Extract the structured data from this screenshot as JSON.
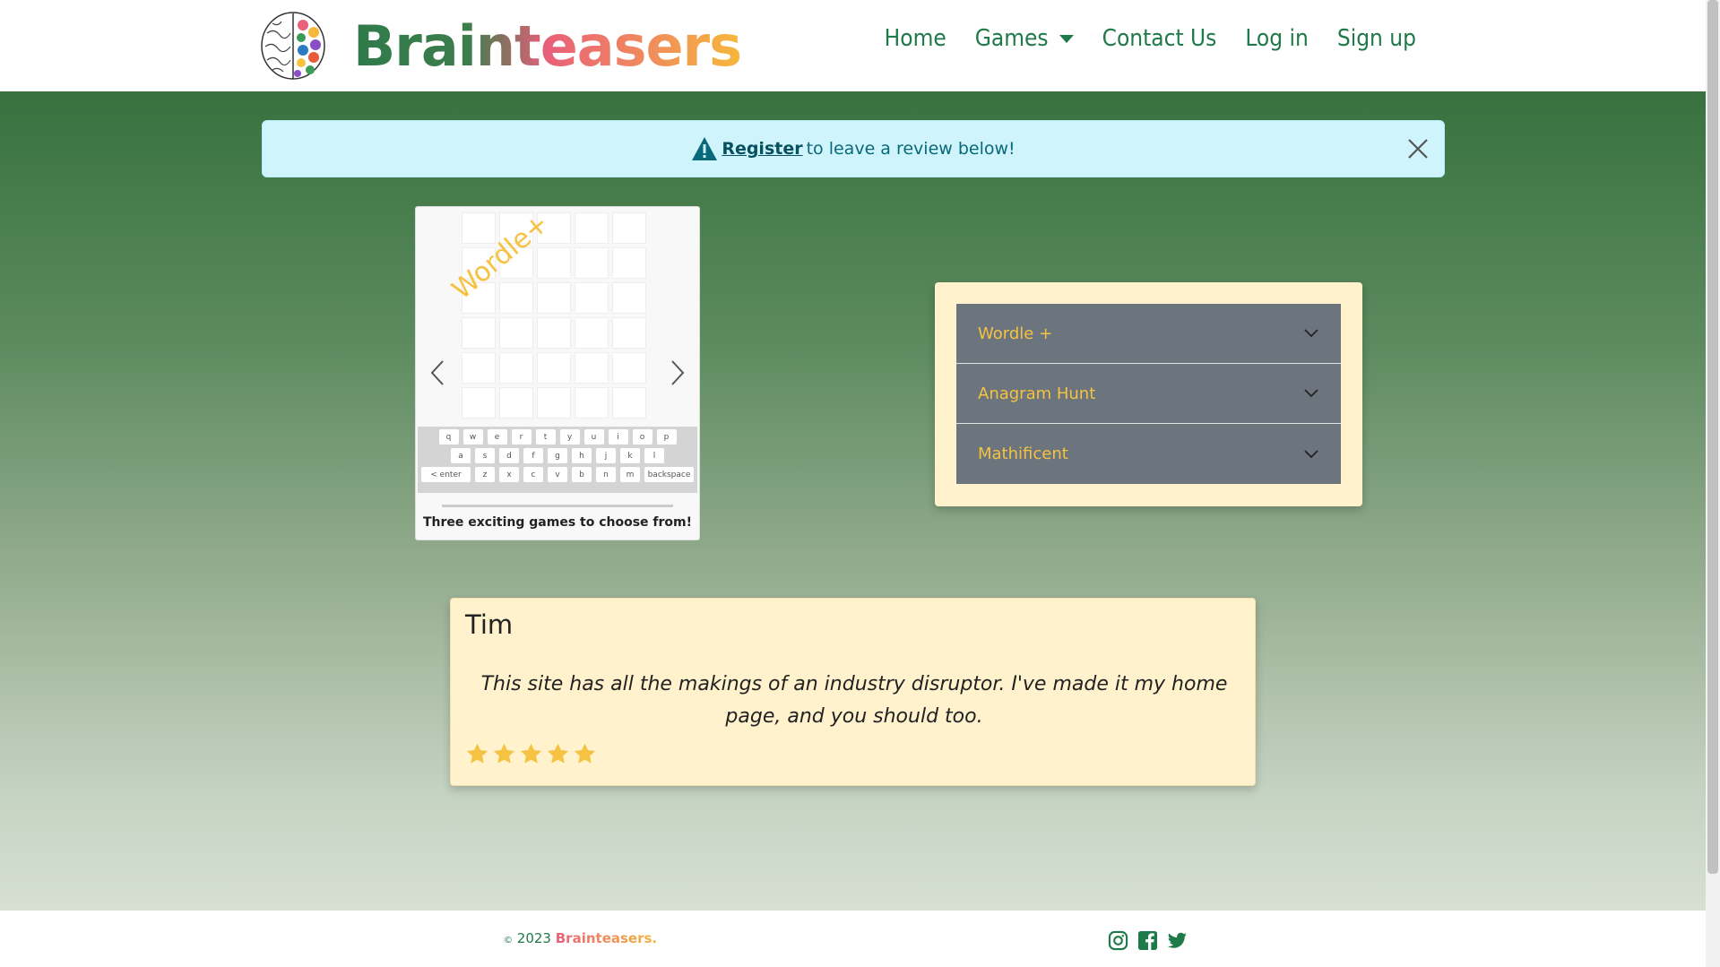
{
  "brand": {
    "name": "Brainteasers",
    "logo_icon": "brain-icon"
  },
  "nav": {
    "items": [
      {
        "label": "Home"
      },
      {
        "label": "Games"
      },
      {
        "label": "Contact Us"
      },
      {
        "label": "Log in"
      },
      {
        "label": "Sign up"
      }
    ]
  },
  "alert": {
    "link_text": "Register",
    "message": "to leave a review below!",
    "icon": "warning-icon",
    "close_icon": "close-icon"
  },
  "carousel": {
    "stamp": "Wordle+",
    "caption": "Three exciting games to choose from!",
    "keyboard": {
      "row1": [
        "q",
        "w",
        "e",
        "r",
        "t",
        "y",
        "u",
        "i",
        "o",
        "p"
      ],
      "row2": [
        "a",
        "s",
        "d",
        "f",
        "g",
        "h",
        "j",
        "k",
        "l"
      ],
      "row3": [
        "< enter",
        "z",
        "x",
        "c",
        "v",
        "b",
        "n",
        "m",
        "backspace"
      ]
    }
  },
  "accordion": {
    "items": [
      {
        "label": "Wordle +"
      },
      {
        "label": "Anagram Hunt"
      },
      {
        "label": "Mathificent"
      }
    ]
  },
  "review": {
    "name": "Tim",
    "text": "This site has all the makings of an industry disruptor. I've made it my home page, and you should too.",
    "rating": 5
  },
  "footer": {
    "copyright_symbol": "©",
    "year": "2023",
    "brand": "Brainteasers.",
    "social": [
      "instagram-icon",
      "facebook-icon",
      "twitter-icon"
    ]
  },
  "colors": {
    "brand_green": "#1f7a4a",
    "accent_gold": "#f5c242",
    "alert_bg": "#cff4fc",
    "card_bg": "#fff2cc",
    "accordion_bg": "#6c757d"
  }
}
